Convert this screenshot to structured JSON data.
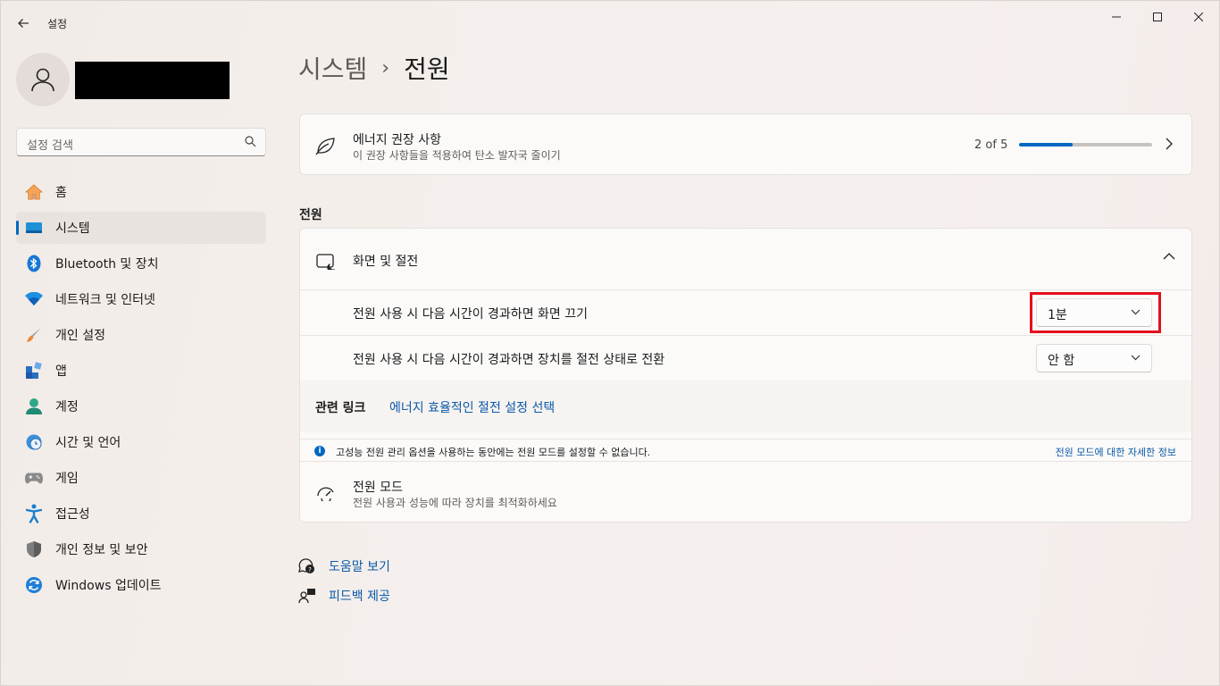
{
  "window": {
    "app_title": "설정",
    "controls": [
      "minimize",
      "maximize",
      "close"
    ]
  },
  "sidebar": {
    "search_placeholder": "설정 검색",
    "items": [
      {
        "label": "홈",
        "icon": "home-icon",
        "active": false
      },
      {
        "label": "시스템",
        "icon": "system-icon",
        "active": true
      },
      {
        "label": "Bluetooth 및 장치",
        "icon": "bluetooth-icon",
        "active": false
      },
      {
        "label": "네트워크 및 인터넷",
        "icon": "wifi-icon",
        "active": false
      },
      {
        "label": "개인 설정",
        "icon": "brush-icon",
        "active": false
      },
      {
        "label": "앱",
        "icon": "apps-icon",
        "active": false
      },
      {
        "label": "계정",
        "icon": "account-icon",
        "active": false
      },
      {
        "label": "시간 및 언어",
        "icon": "clock-globe-icon",
        "active": false
      },
      {
        "label": "게임",
        "icon": "gamepad-icon",
        "active": false
      },
      {
        "label": "접근성",
        "icon": "accessibility-icon",
        "active": false
      },
      {
        "label": "개인 정보 및 보안",
        "icon": "shield-icon",
        "active": false
      },
      {
        "label": "Windows 업데이트",
        "icon": "update-icon",
        "active": false
      }
    ]
  },
  "breadcrumb": {
    "parent": "시스템",
    "separator": "›",
    "current": "전원"
  },
  "recommendation": {
    "title": "에너지 권장 사항",
    "subtitle": "이 권장 사항들을 적용하여 탄소 발자국 줄이기",
    "progress_text": "2 of 5",
    "progress_fraction": 0.4
  },
  "power_section": {
    "title": "전원",
    "screen_sleep": {
      "header": "화면 및 절전",
      "screen_off_label": "전원 사용 시 다음 시간이 경과하면 화면 끄기",
      "screen_off_value": "1분",
      "sleep_label": "전원 사용 시 다음 시간이 경과하면 장치를 절전 상태로 전환",
      "sleep_value": "안 함"
    },
    "related": {
      "label": "관련 링크",
      "link": "에너지 효율적인 절전 설정 선택"
    },
    "info": {
      "text": "고성능 전원 관리 옵션을 사용하는 동안에는 전원 모드를 설정할 수 없습니다.",
      "link": "전원 모드에 대한 자세한 정보"
    },
    "power_mode": {
      "title": "전원 모드",
      "subtitle": "전원 사용과 성능에 따라 장치를 최적화하세요"
    }
  },
  "help": {
    "get_help": "도움말 보기",
    "feedback": "피드백 제공"
  },
  "colors": {
    "accent": "#0067c0",
    "highlight": "#e3101c",
    "link": "#0a5aaa"
  }
}
